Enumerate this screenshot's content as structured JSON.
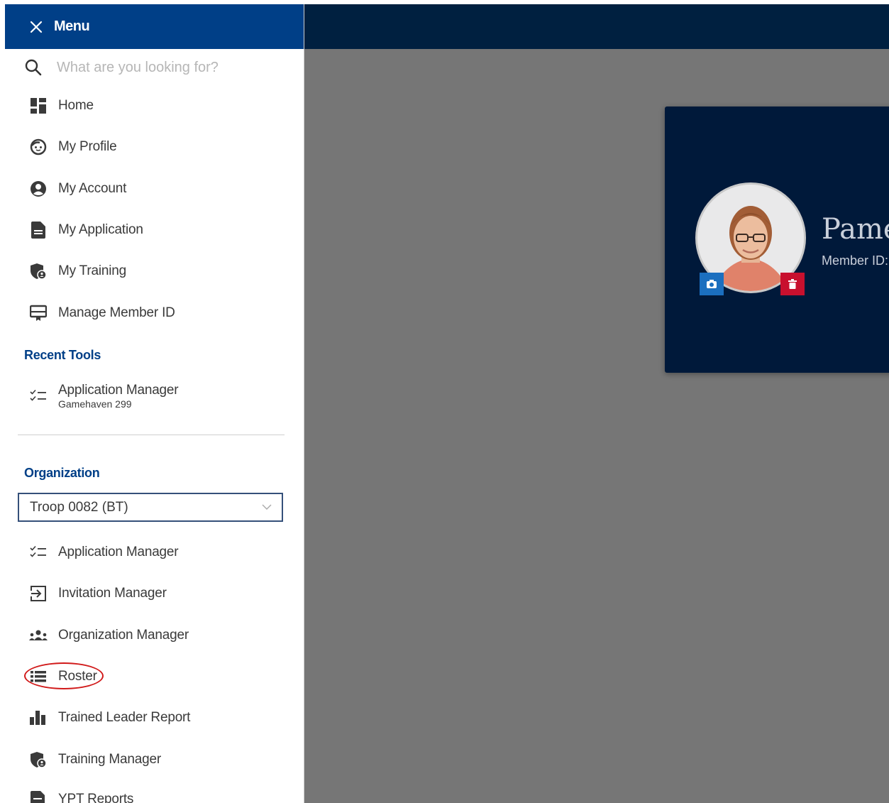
{
  "menu": {
    "title": "Menu"
  },
  "search": {
    "placeholder": "What are you looking for?"
  },
  "nav": [
    {
      "label": "Home",
      "icon": "dashboard-icon"
    },
    {
      "label": "My Profile",
      "icon": "smiley-face-icon"
    },
    {
      "label": "My Account",
      "icon": "account-circle-icon"
    },
    {
      "label": "My Application",
      "icon": "document-icon"
    },
    {
      "label": "My Training",
      "icon": "shield-user-icon"
    },
    {
      "label": "Manage Member ID",
      "icon": "id-card-icon"
    }
  ],
  "recent_tools": {
    "heading": "Recent Tools",
    "items": [
      {
        "label": "Application Manager",
        "sub": "Gamehaven 299",
        "icon": "checklist-icon"
      }
    ]
  },
  "organization": {
    "heading": "Organization",
    "selected": "Troop 0082 (BT)",
    "tools": [
      {
        "label": "Application Manager",
        "icon": "checklist-icon"
      },
      {
        "label": "Invitation Manager",
        "icon": "enter-icon"
      },
      {
        "label": "Organization Manager",
        "icon": "group-icon"
      },
      {
        "label": "Roster",
        "icon": "list-icon",
        "annotated": true
      },
      {
        "label": "Trained Leader Report",
        "icon": "bar-chart-icon"
      },
      {
        "label": "Training Manager",
        "icon": "shield-user-icon"
      },
      {
        "label": "YPT Reports",
        "icon": "report-icon"
      }
    ]
  },
  "profile_card": {
    "name_partial": "Pame",
    "member_id_label": "Member ID:"
  },
  "colors": {
    "menu_header": "#003f87",
    "topbar": "#002040",
    "overlay": "#767676",
    "card": "#00193a",
    "section_heading": "#003f87",
    "annotation": "#d11a1a"
  }
}
